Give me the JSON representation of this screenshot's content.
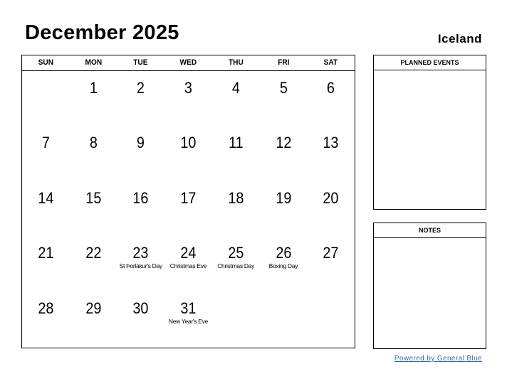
{
  "header": {
    "title": "December 2025",
    "country": "Iceland"
  },
  "weekdays": [
    "SUN",
    "MON",
    "TUE",
    "WED",
    "THU",
    "FRI",
    "SAT"
  ],
  "weeks": [
    [
      {
        "d": ""
      },
      {
        "d": "1"
      },
      {
        "d": "2"
      },
      {
        "d": "3"
      },
      {
        "d": "4"
      },
      {
        "d": "5"
      },
      {
        "d": "6"
      }
    ],
    [
      {
        "d": "7"
      },
      {
        "d": "8"
      },
      {
        "d": "9"
      },
      {
        "d": "10"
      },
      {
        "d": "11"
      },
      {
        "d": "12"
      },
      {
        "d": "13"
      }
    ],
    [
      {
        "d": "14"
      },
      {
        "d": "15"
      },
      {
        "d": "16"
      },
      {
        "d": "17"
      },
      {
        "d": "18"
      },
      {
        "d": "19"
      },
      {
        "d": "20"
      }
    ],
    [
      {
        "d": "21"
      },
      {
        "d": "22"
      },
      {
        "d": "23",
        "e": "St Þorlákur's Day"
      },
      {
        "d": "24",
        "e": "Christmas Eve"
      },
      {
        "d": "25",
        "e": "Christmas Day"
      },
      {
        "d": "26",
        "e": "Boxing Day"
      },
      {
        "d": "27"
      }
    ],
    [
      {
        "d": "28"
      },
      {
        "d": "29"
      },
      {
        "d": "30"
      },
      {
        "d": "31",
        "e": "New Year's Eve"
      },
      {
        "d": ""
      },
      {
        "d": ""
      },
      {
        "d": ""
      }
    ]
  ],
  "sidebar": {
    "planned_events_label": "PLANNED EVENTS",
    "notes_label": "NOTES"
  },
  "footer": {
    "powered_by": "Powered by General Blue",
    "link_color": "#2e6db4"
  }
}
